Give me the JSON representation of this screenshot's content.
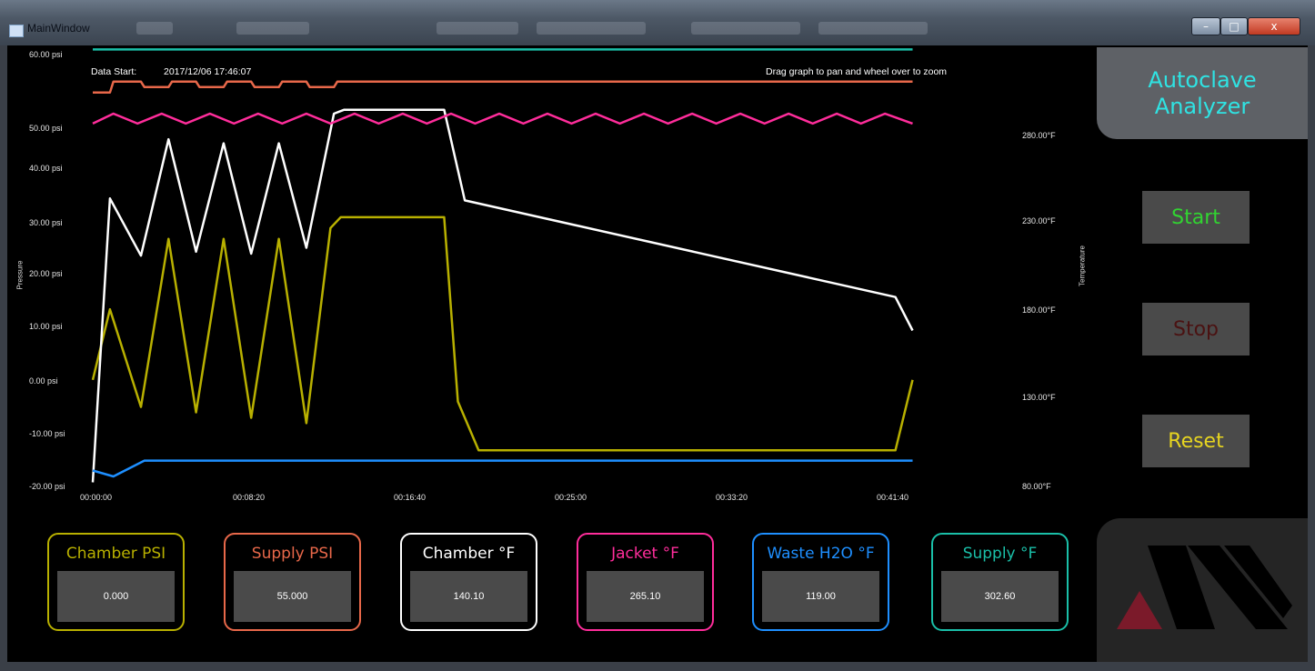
{
  "window": {
    "title": "MainWindow",
    "controls": {
      "minimize": "–",
      "maximize": "□",
      "close": "x"
    }
  },
  "chart": {
    "data_start_label": "Data Start:",
    "data_start_value": "2017/12/06 17:46:07",
    "hint": "Drag graph to pan and wheel over to zoom",
    "left_axis_title": "Pressure",
    "right_axis_title": "Temperature",
    "left_ticks": [
      "60.00 psi",
      "50.00 psi",
      "40.00 psi",
      "30.00 psi",
      "20.00 psi",
      "10.00 psi",
      "0.00 psi",
      "-10.00 psi",
      "-20.00 psi"
    ],
    "right_ticks": [
      "280.00°F",
      "230.00°F",
      "180.00°F",
      "130.00°F",
      "80.00°F"
    ],
    "x_ticks": [
      "00:00:00",
      "00:08:20",
      "00:16:40",
      "00:25:00",
      "00:33:20",
      "00:41:40"
    ]
  },
  "chart_data": {
    "type": "line",
    "x_unit": "seconds",
    "xlim": [
      0,
      2500
    ],
    "ylim_left": [
      -20,
      60
    ],
    "ylim_right": [
      80,
      300
    ],
    "series": [
      {
        "name": "Chamber PSI",
        "axis": "left",
        "color": "#b8b000",
        "points": [
          [
            0,
            0
          ],
          [
            50,
            13
          ],
          [
            140,
            -5
          ],
          [
            220,
            26
          ],
          [
            300,
            -6
          ],
          [
            380,
            26
          ],
          [
            460,
            -7
          ],
          [
            540,
            26
          ],
          [
            620,
            -8
          ],
          [
            690,
            28
          ],
          [
            720,
            30
          ],
          [
            1020,
            30
          ],
          [
            1060,
            -4
          ],
          [
            1120,
            -13
          ],
          [
            2330,
            -13
          ],
          [
            2380,
            0
          ]
        ]
      },
      {
        "name": "Supply PSI",
        "axis": "left",
        "color": "#e8684a",
        "points": [
          [
            0,
            53
          ],
          [
            50,
            53
          ],
          [
            60,
            55
          ],
          [
            140,
            55
          ],
          [
            150,
            54
          ],
          [
            220,
            54
          ],
          [
            230,
            55
          ],
          [
            300,
            55
          ],
          [
            310,
            54
          ],
          [
            380,
            54
          ],
          [
            390,
            55
          ],
          [
            460,
            55
          ],
          [
            470,
            54
          ],
          [
            540,
            54
          ],
          [
            550,
            55
          ],
          [
            620,
            55
          ],
          [
            630,
            54
          ],
          [
            700,
            54
          ],
          [
            710,
            55
          ],
          [
            2380,
            55
          ]
        ]
      },
      {
        "name": "Chamber °F",
        "axis": "right",
        "color": "#ffffff",
        "points": [
          [
            0,
            83
          ],
          [
            50,
            227
          ],
          [
            140,
            198
          ],
          [
            220,
            257
          ],
          [
            300,
            200
          ],
          [
            380,
            255
          ],
          [
            460,
            199
          ],
          [
            540,
            255
          ],
          [
            620,
            202
          ],
          [
            700,
            270
          ],
          [
            730,
            272
          ],
          [
            1020,
            272
          ],
          [
            1080,
            226
          ],
          [
            2330,
            177
          ],
          [
            2380,
            160
          ]
        ]
      },
      {
        "name": "Jacket °F",
        "axis": "right",
        "color": "#ff2d9b",
        "points": [
          [
            0,
            265
          ],
          [
            60,
            270
          ],
          [
            130,
            265
          ],
          [
            200,
            270
          ],
          [
            270,
            265
          ],
          [
            340,
            270
          ],
          [
            410,
            265
          ],
          [
            480,
            270
          ],
          [
            550,
            265
          ],
          [
            620,
            270
          ],
          [
            690,
            265
          ],
          [
            760,
            270
          ],
          [
            830,
            265
          ],
          [
            900,
            270
          ],
          [
            970,
            265
          ],
          [
            1040,
            270
          ],
          [
            1110,
            265
          ],
          [
            1180,
            270
          ],
          [
            1250,
            265
          ],
          [
            1320,
            270
          ],
          [
            1390,
            265
          ],
          [
            1460,
            270
          ],
          [
            1530,
            265
          ],
          [
            1600,
            270
          ],
          [
            1670,
            265
          ],
          [
            1740,
            270
          ],
          [
            1810,
            265
          ],
          [
            1880,
            270
          ],
          [
            1950,
            265
          ],
          [
            2020,
            270
          ],
          [
            2090,
            265
          ],
          [
            2160,
            270
          ],
          [
            2230,
            265
          ],
          [
            2300,
            270
          ],
          [
            2380,
            265
          ]
        ]
      },
      {
        "name": "Waste H2O °F",
        "axis": "right",
        "color": "#1e8fff",
        "points": [
          [
            0,
            89
          ],
          [
            60,
            86
          ],
          [
            150,
            94
          ],
          [
            300,
            94
          ],
          [
            500,
            94
          ],
          [
            700,
            94
          ],
          [
            1000,
            94
          ],
          [
            1300,
            94
          ],
          [
            1600,
            94
          ],
          [
            2000,
            94
          ],
          [
            2380,
            94
          ]
        ]
      },
      {
        "name": "Supply °F",
        "axis": "right",
        "color": "#1abfa8",
        "points": [
          [
            0,
            302.6
          ],
          [
            2380,
            302.6
          ]
        ]
      }
    ]
  },
  "readouts": [
    {
      "label": "Chamber PSI",
      "value": "0.000",
      "color": "#b8b000"
    },
    {
      "label": "Supply PSI",
      "value": "55.000",
      "color": "#e8684a"
    },
    {
      "label": "Chamber °F",
      "value": "140.10",
      "color": "#ffffff"
    },
    {
      "label": "Jacket °F",
      "value": "265.10",
      "color": "#ff2d9b"
    },
    {
      "label": "Waste H2O °F",
      "value": "119.00",
      "color": "#1e8fff"
    },
    {
      "label": "Supply °F",
      "value": "302.60",
      "color": "#1abfa8"
    }
  ],
  "brand": {
    "line1": "Autoclave",
    "line2": "Analyzer",
    "logo": "company-logo"
  },
  "buttons": {
    "start": {
      "label": "Start",
      "color": "#31d431"
    },
    "stop": {
      "label": "Stop",
      "color": "#4a1212"
    },
    "reset": {
      "label": "Reset",
      "color": "#e6d420"
    }
  }
}
